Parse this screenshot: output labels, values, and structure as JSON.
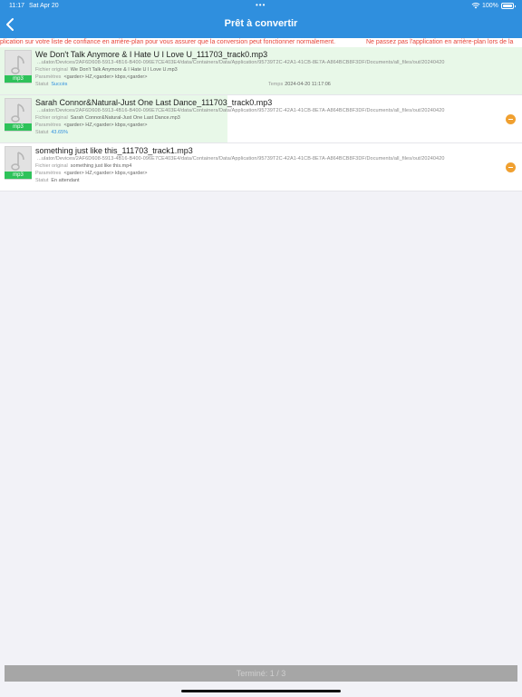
{
  "status_bar": {
    "time": "11:17",
    "date": "Sat Apr 20",
    "dots": "•••",
    "battery": "100%"
  },
  "header": {
    "title": "Prêt à convertir",
    "back_icon": "chevron-left-icon"
  },
  "marquee": {
    "text_left": "plication sur votre liste de confiance en arrière-plan pour vous assurer que la conversion peut fonctionner normalement.",
    "text_right": "Ne passez pas l'application en arrière-plan lors de la"
  },
  "labels": {
    "original": "Fichier original",
    "params": "Paramètres",
    "status": "Statut",
    "time": "Temps"
  },
  "items": [
    {
      "name": "We Don't Talk Anymore & I Hate U I Love U_111703_track0.mp3",
      "path": "...ulator/Devices/2AF6D608-5913-4B16-B400-096E7CE403E4/data/Containers/Data/Application/95739T2C-42A1-41CB-8E7A-A864BCB8F3DF/Documents/all_files/out/20240420",
      "original": "We Don't Talk Anymore & I Hate U I Love U.mp3",
      "params": "<garder> HZ,<garder> kbps,<garder>",
      "status": "Succès",
      "time": "2024-04-20 11:17:06",
      "format": "mp3",
      "progress": 1.0
    },
    {
      "name": "Sarah Connor&Natural-Just One Last Dance_111703_track0.mp3",
      "path": "...ulator/Devices/2AF6D608-5913-4B16-B400-096E7CE403E4/data/Containers/Data/Application/95739T2C-42A1-41CB-8E7A-A864BCB8F3DF/Documents/all_files/out/20240420",
      "original": "Sarah Connor&Natural-Just One Last Dance.mp3",
      "params": "<garder> HZ,<garder> kbps,<garder>",
      "status": "43.65%",
      "format": "mp3",
      "progress": 0.4365
    },
    {
      "name": "something just like this_111703_track1.mp3",
      "path": "...ulator/Devices/2AF6D608-5913-4B16-B400-096E7CE403E4/data/Containers/Data/Application/95739T2C-42A1-41CB-8E7A-A864BCB8F3DF/Documents/all_files/out/20240420",
      "original": "something just like this.mp4",
      "params": "<garder> HZ,<garder> kbps,<garder>",
      "status": "En attendant",
      "format": "mp3",
      "progress": 0
    }
  ],
  "footer": {
    "label": "Terminé: 1 / 3"
  },
  "colors": {
    "accent": "#2f8fde",
    "success_fill": "#e8f8e8",
    "format_badge": "#2ec25a",
    "remove": "#f0a030",
    "warning_text": "#e6453a"
  }
}
